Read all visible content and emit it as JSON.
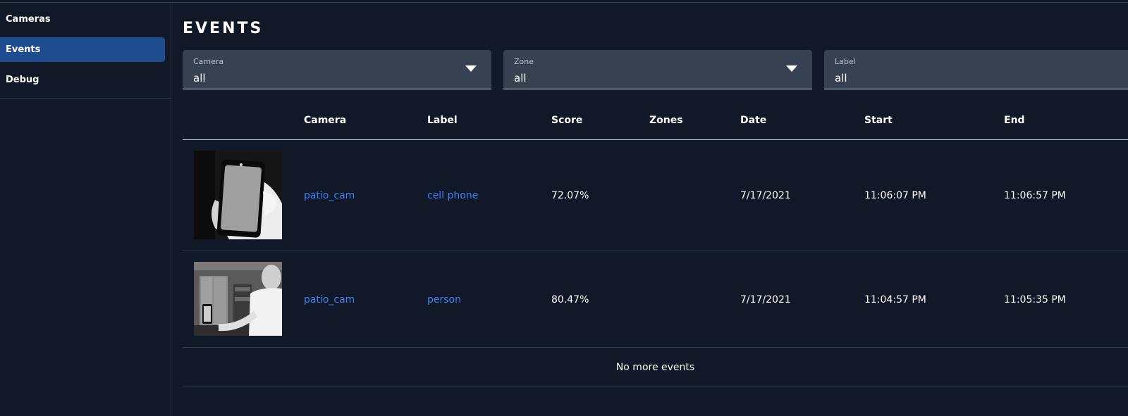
{
  "sidebar": {
    "items": [
      {
        "label": "Cameras",
        "active": false
      },
      {
        "label": "Events",
        "active": true
      },
      {
        "label": "Debug",
        "active": false
      }
    ]
  },
  "page": {
    "title": "EVENTS"
  },
  "filters": [
    {
      "label": "Camera",
      "value": "all",
      "icon": "chevron-down-icon"
    },
    {
      "label": "Zone",
      "value": "all",
      "icon": "chevron-down-icon"
    },
    {
      "label": "Label",
      "value": "all"
    }
  ],
  "table": {
    "columns": [
      "Camera",
      "Label",
      "Score",
      "Zones",
      "Date",
      "Start",
      "End"
    ],
    "rows": [
      {
        "camera": "patio_cam",
        "label": "cell phone",
        "score": "72.07%",
        "zones": "",
        "date": "7/17/2021",
        "start": "11:06:07 PM",
        "end": "11:06:57 PM",
        "thumbnail": "cell-phone-snapshot"
      },
      {
        "camera": "patio_cam",
        "label": "person",
        "score": "80.47%",
        "zones": "",
        "date": "7/17/2021",
        "start": "11:04:57 PM",
        "end": "11:05:35 PM",
        "thumbnail": "person-snapshot"
      }
    ],
    "footer": "No more events"
  },
  "colors": {
    "background": "#111827",
    "active": "#1f4b8f",
    "link": "#3b82f6",
    "filter_bg": "#374151"
  }
}
